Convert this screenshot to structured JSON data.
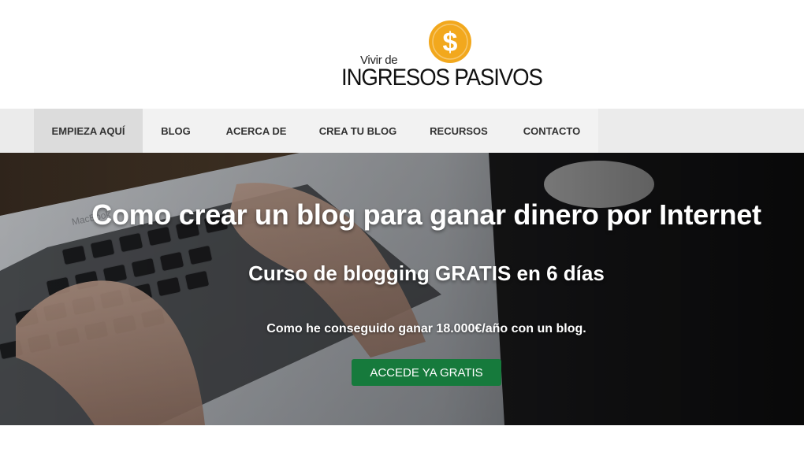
{
  "logo": {
    "small_text": "Vivir de",
    "big_text": "INGRESOS PASIVOS",
    "coin_symbol": "$",
    "coin_color": "#f2a81d"
  },
  "nav": {
    "items": [
      {
        "label": "EMPIEZA AQUÍ",
        "active": true
      },
      {
        "label": "BLOG"
      },
      {
        "label": "ACERCA DE"
      },
      {
        "label": "CREA TU BLOG"
      },
      {
        "label": "RECURSOS"
      },
      {
        "label": "CONTACTO"
      }
    ]
  },
  "hero": {
    "title": "Como crear un blog para ganar dinero por Internet",
    "subtitle": "Curso de blogging GRATIS en 6 días",
    "description": "Como he conseguido ganar 18.000€/año con un blog.",
    "cta_label": "ACCEDE YA GRATIS",
    "cta_color": "#167a3c",
    "laptop_brand": "MacBook"
  }
}
